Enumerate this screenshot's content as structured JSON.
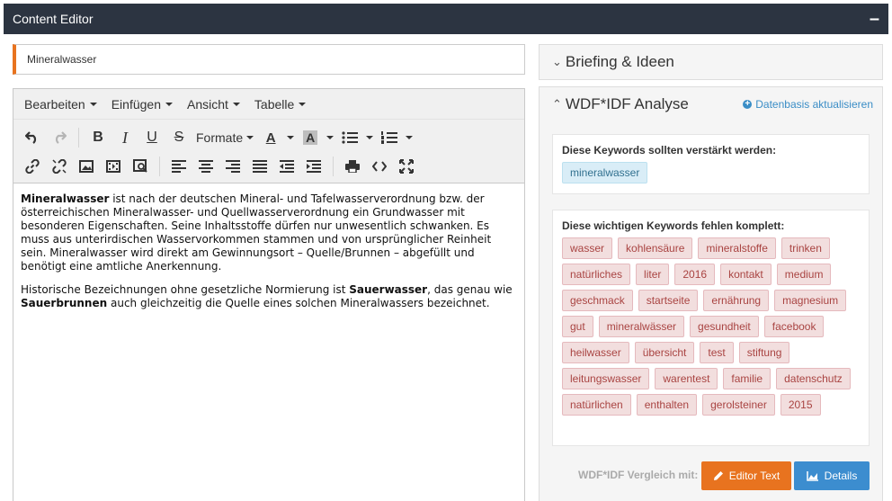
{
  "window": {
    "title": "Content Editor",
    "collapse": "–"
  },
  "title_field": {
    "value": "Mineralwasser"
  },
  "editor": {
    "menus": [
      "Bearbeiten",
      "Einfügen",
      "Ansicht",
      "Tabelle"
    ],
    "format_label": "Formate",
    "paragraph1": {
      "lead": "Mineralwasser",
      "text": " ist nach der deutschen Mineral- und Tafelwasserverordnung bzw. der österreichischen Mineralwasser- und Quellwasserverordnung ein Grundwasser mit besonderen Eigenschaften. Seine Inhaltsstoffe dürfen nur unwesentlich schwanken. Es muss aus unterirdischen Wasservorkommen stammen und von ursprünglicher Reinheit sein. Mineralwasser wird direkt am Gewinnungsort – Quelle/Brunnen – abgefüllt und benötigt eine amtliche Anerkennung."
    },
    "paragraph2": {
      "t1": "Historische Bezeichnungen ohne gesetzliche Normierung ist ",
      "b1": "Sauerwasser",
      "t2": ", das genau wie ",
      "b2": "Sauerbrunnen",
      "t3": " auch gleichzeitig die Quelle eines solchen Mineralwassers bezeichnet."
    }
  },
  "briefing": {
    "title": "Briefing & Ideen"
  },
  "analysis": {
    "title": "WDF*IDF Analyse",
    "refresh_label": "Datenbasis aktualisieren",
    "boost_title": "Diese Keywords sollten verstärkt werden:",
    "boost_keywords": [
      "mineralwasser"
    ],
    "missing_title": "Diese wichtigen Keywords fehlen komplett:",
    "missing_keywords": [
      "wasser",
      "kohlensäure",
      "mineralstoffe",
      "trinken",
      "natürliches",
      "liter",
      "2016",
      "kontakt",
      "medium",
      "geschmack",
      "startseite",
      "ernährung",
      "magnesium",
      "gut",
      "mineralwässer",
      "gesundheit",
      "facebook",
      "heilwasser",
      "übersicht",
      "test",
      "stiftung",
      "leitungswasser",
      "warentest",
      "familie",
      "datenschutz",
      "natürlichen",
      "enthalten",
      "gerolsteiner",
      "2015"
    ],
    "compare_label": "WDF*IDF Vergleich mit:",
    "btn_editor": "Editor Text",
    "btn_details": "Details"
  },
  "colors": {
    "accent_orange": "#e8731f",
    "accent_blue": "#3c8dcf",
    "header_bg": "#2c3441"
  }
}
